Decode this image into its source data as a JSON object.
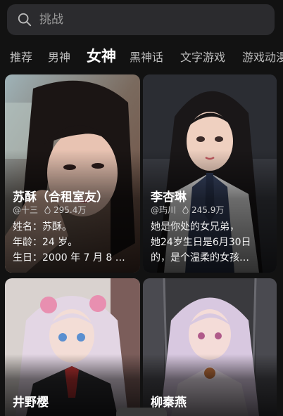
{
  "search": {
    "placeholder": "挑战"
  },
  "tabs": [
    {
      "label": "推荐"
    },
    {
      "label": "男神"
    },
    {
      "label": "女神"
    },
    {
      "label": "黑神话"
    },
    {
      "label": "文字游戏"
    },
    {
      "label": "游戏动漫"
    }
  ],
  "active_tab": "女神",
  "cards": [
    {
      "name": "苏酥（合租室友）",
      "author": "@十三",
      "popularity": "295.4万",
      "desc": [
        "姓名：苏酥。",
        "年龄：24 岁。",
        "生日：2000 年 7 月 8 …"
      ]
    },
    {
      "name": "李杏琳",
      "author": "@玙川",
      "popularity": "245.9万",
      "desc": [
        "她是你处的女兄弟，",
        "她24岁生日是6月30日",
        "的，是个温柔的女孩…"
      ]
    },
    {
      "name": "井野樱"
    },
    {
      "name": "柳秦燕"
    }
  ],
  "colors": {
    "background": "#121212",
    "search_bg": "#2b2b2e",
    "tab_inactive": "#bdbdbd"
  }
}
